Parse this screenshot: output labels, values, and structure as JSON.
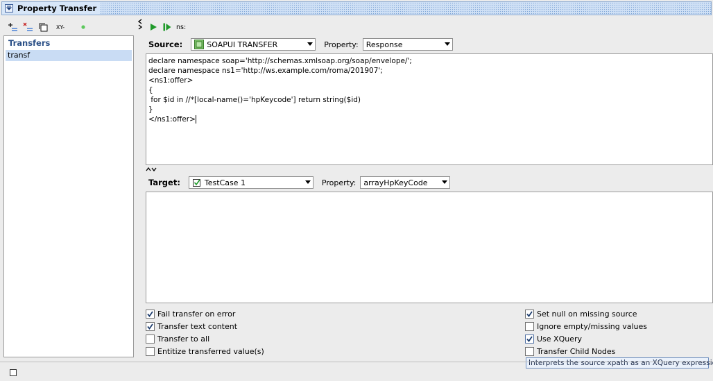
{
  "window": {
    "title": "Property Transfer"
  },
  "left_toolbar": {
    "icons": [
      "add-transfer-icon",
      "remove-transfer-icon",
      "copy-transfer-icon",
      "rename-icon",
      "status-dot-icon"
    ],
    "rename_label": "XY-",
    "status_color": "#5cc85c"
  },
  "transfers": {
    "header": "Transfers",
    "items": [
      "transf"
    ]
  },
  "right_toolbar": {
    "ns_label": "ns:"
  },
  "source": {
    "label": "Source:",
    "step": "SOAPUI TRANSFER",
    "property_label": "Property:",
    "property": "Response"
  },
  "source_expression": [
    "declare namespace soap='http://schemas.xmlsoap.org/soap/envelope/';",
    "declare namespace ns1='http://ws.example.com/roma/201907';",
    "<ns1:offer>",
    "{",
    " for $id in //*[local-name()='hpKeycode'] return string($id)",
    "}",
    "</ns1:offer>"
  ],
  "target": {
    "label": "Target:",
    "step": "TestCase 1",
    "property_label": "Property:",
    "property": "arrayHpKeyCode"
  },
  "options_left": [
    {
      "label": "Fail transfer on error",
      "checked": true
    },
    {
      "label": "Transfer text content",
      "checked": true
    },
    {
      "label": "Transfer to all",
      "checked": false
    },
    {
      "label": "Entitize transferred value(s)",
      "checked": false
    }
  ],
  "options_right": [
    {
      "label": "Set null on missing source",
      "checked": true
    },
    {
      "label": "Ignore empty/missing values",
      "checked": false
    },
    {
      "label": "Use XQuery",
      "checked": true
    },
    {
      "label": "Transfer Child Nodes",
      "checked": false
    }
  ],
  "tooltip": "Interprets the source xpath as an XQuery expression",
  "colors": {
    "accent": "#2a4f86",
    "selection": "#c9dcf4",
    "run_green": "#1f9a2a"
  }
}
